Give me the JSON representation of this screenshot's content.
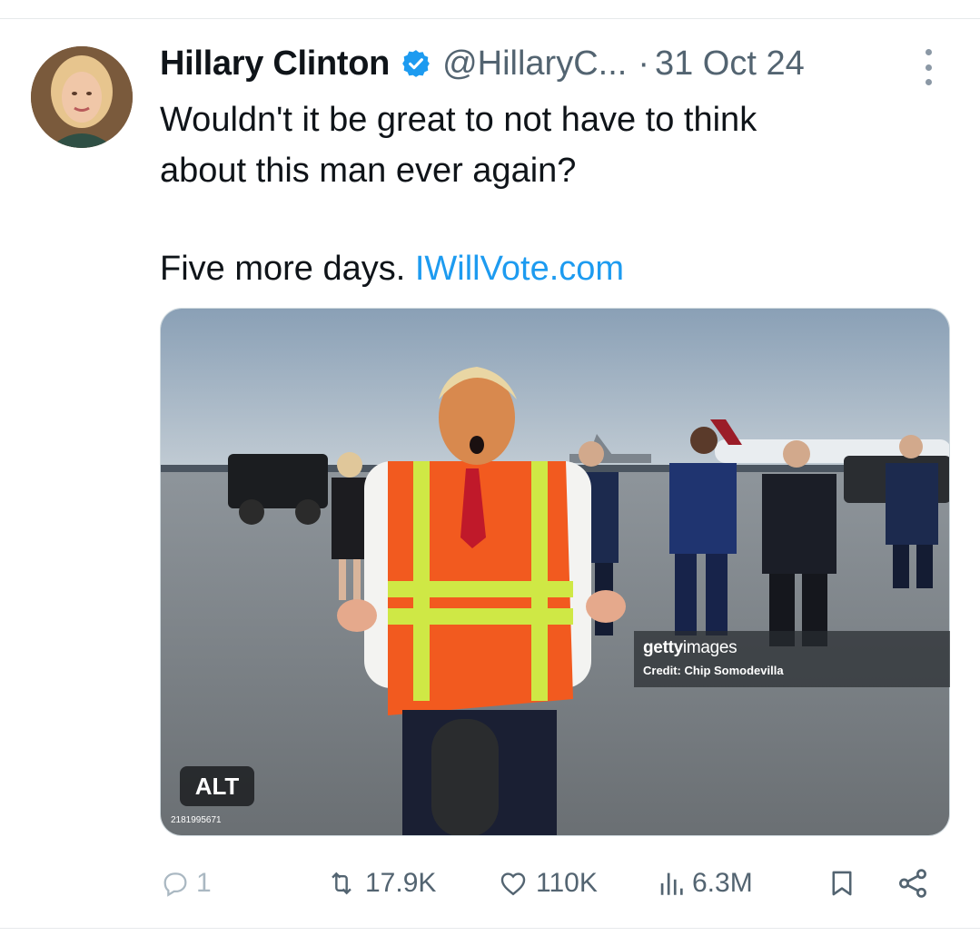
{
  "tweet": {
    "author_name": "Hillary Clinton",
    "handle": "@HillaryC...",
    "separator": "·",
    "date": "31 Oct 24",
    "text_line1": "Wouldn't it be great to not have to think",
    "text_line2": "about this man ever again?",
    "text_line3": "Five more days.",
    "link": "IWillVote.com",
    "verified_icon": "verified-badge-icon",
    "accent_color": "#1d9bf0"
  },
  "media": {
    "watermark_brand_bold": "getty",
    "watermark_brand_light": "images",
    "watermark_credit": "Credit: Chip Somodevilla",
    "alt_label": "ALT",
    "image_id": "2181995671"
  },
  "actions": {
    "replies": "1",
    "retweets": "17.9K",
    "likes": "110K",
    "views": "6.3M",
    "icons": [
      "reply-icon",
      "retweet-icon",
      "like-icon",
      "views-icon",
      "bookmark-icon",
      "share-icon"
    ]
  }
}
